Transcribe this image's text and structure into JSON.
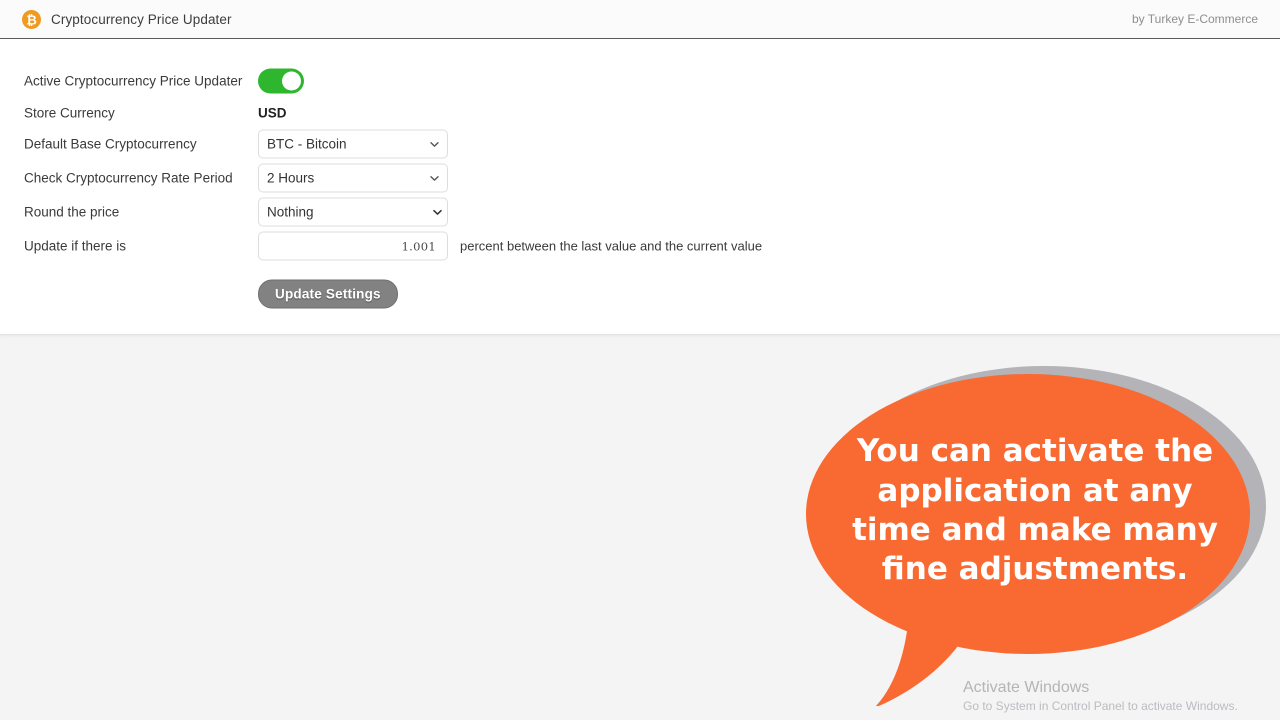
{
  "header": {
    "icon": "bitcoin-icon",
    "title": "Cryptocurrency Price Updater",
    "attribution": "by Turkey E-Commerce"
  },
  "form": {
    "rows": {
      "active": {
        "label": "Active Cryptocurrency Price Updater",
        "toggle_state": "on"
      },
      "store_currency": {
        "label": "Store Currency",
        "value": "USD"
      },
      "base_currency": {
        "label": "Default Base Cryptocurrency",
        "value": "BTC - Bitcoin",
        "options": [
          "BTC - Bitcoin"
        ]
      },
      "rate_period": {
        "label": "Check Cryptocurrency Rate Period",
        "value": "2 Hours",
        "options": [
          "2 Hours"
        ]
      },
      "round_price": {
        "label": "Round the price",
        "value": "Nothing",
        "options": [
          "Nothing"
        ]
      },
      "update_threshold": {
        "label": "Update if there is",
        "value": "1.001",
        "suffix": "percent between the last value and the current value"
      }
    },
    "submit_label": "Update Settings"
  },
  "callout": {
    "text": "You can activate the application at any time and make many fine adjustments.",
    "fill_color": "#F96A33",
    "shadow_color": "#B3B3B8"
  },
  "watermark": {
    "title": "Activate Windows",
    "subtitle": "Go to System in Control Panel to activate Windows."
  }
}
